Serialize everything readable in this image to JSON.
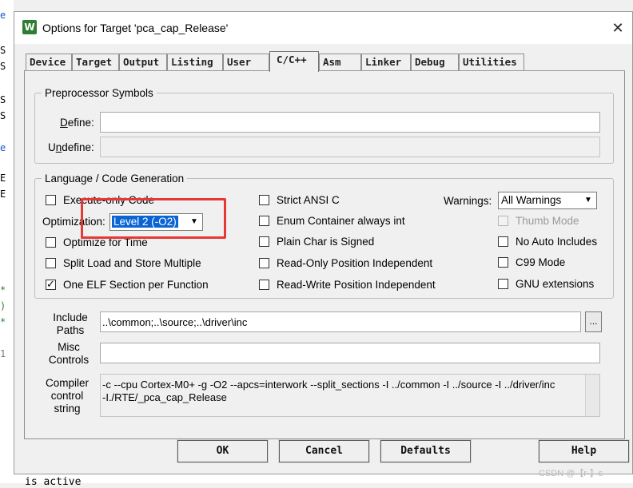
{
  "window": {
    "title": "Options for Target 'pca_cap_Release'",
    "close_glyph": "✕",
    "app_icon_letter": "W"
  },
  "tabs": [
    {
      "label": "Device"
    },
    {
      "label": "Target"
    },
    {
      "label": "Output"
    },
    {
      "label": "Listing"
    },
    {
      "label": "User"
    },
    {
      "label": "C/C++",
      "active": true
    },
    {
      "label": "Asm"
    },
    {
      "label": "Linker"
    },
    {
      "label": "Debug"
    },
    {
      "label": "Utilities"
    }
  ],
  "preprocessor": {
    "legend": "Preprocessor Symbols",
    "define_label": "Define:",
    "define_value": "",
    "undefine_label": "Undefine:",
    "undefine_value": ""
  },
  "language": {
    "legend": "Language / Code Generation",
    "execute_only_code": {
      "label": "Execute-only Code",
      "checked": false
    },
    "optimization_label": "Optimization:",
    "optimization_value": "Level 2 (-O2)",
    "optimize_for_time": {
      "label": "Optimize for Time",
      "checked": false
    },
    "split_load_store": {
      "label": "Split Load and Store Multiple",
      "checked": false
    },
    "one_elf_section": {
      "label": "One ELF Section per Function",
      "checked": true
    },
    "strict_ansi_c": {
      "label": "Strict ANSI C",
      "checked": false
    },
    "enum_container": {
      "label": "Enum Container always int",
      "checked": false
    },
    "plain_char_signed": {
      "label": "Plain Char is Signed",
      "checked": false
    },
    "ro_position_independent": {
      "label": "Read-Only Position Independent",
      "checked": false
    },
    "rw_position_independent": {
      "label": "Read-Write Position Independent",
      "checked": false
    },
    "warnings_label": "Warnings:",
    "warnings_value": "All Warnings",
    "thumb_mode": {
      "label": "Thumb Mode",
      "checked": false,
      "disabled": true
    },
    "no_auto_includes": {
      "label": "No Auto Includes",
      "checked": false
    },
    "c99_mode": {
      "label": "C99 Mode",
      "checked": false
    },
    "gnu_extensions": {
      "label": "GNU extensions",
      "checked": false
    }
  },
  "include_paths": {
    "label_line1": "Include",
    "label_line2": "Paths",
    "value": "..\\common;..\\source;..\\driver\\inc",
    "browse_label": "..."
  },
  "misc_controls": {
    "label_line1": "Misc",
    "label_line2": "Controls",
    "value": ""
  },
  "compiler_control": {
    "label_line1": "Compiler",
    "label_line2": "control",
    "label_line3": "string",
    "line1": "-c --cpu Cortex-M0+ -g -O2 --apcs=interwork --split_sections -I ../common -I ../source -I ../driver/inc",
    "line2": "-I./RTE/_pca_cap_Release"
  },
  "buttons": {
    "ok": "OK",
    "cancel": "Cancel",
    "defaults": "Defaults",
    "help": "Help"
  },
  "background": {
    "bottom_text": "is active"
  },
  "watermark": "CSDN @【r·】s",
  "colors": {
    "highlight_box": "#e53935",
    "selection": "#0a64d4"
  }
}
